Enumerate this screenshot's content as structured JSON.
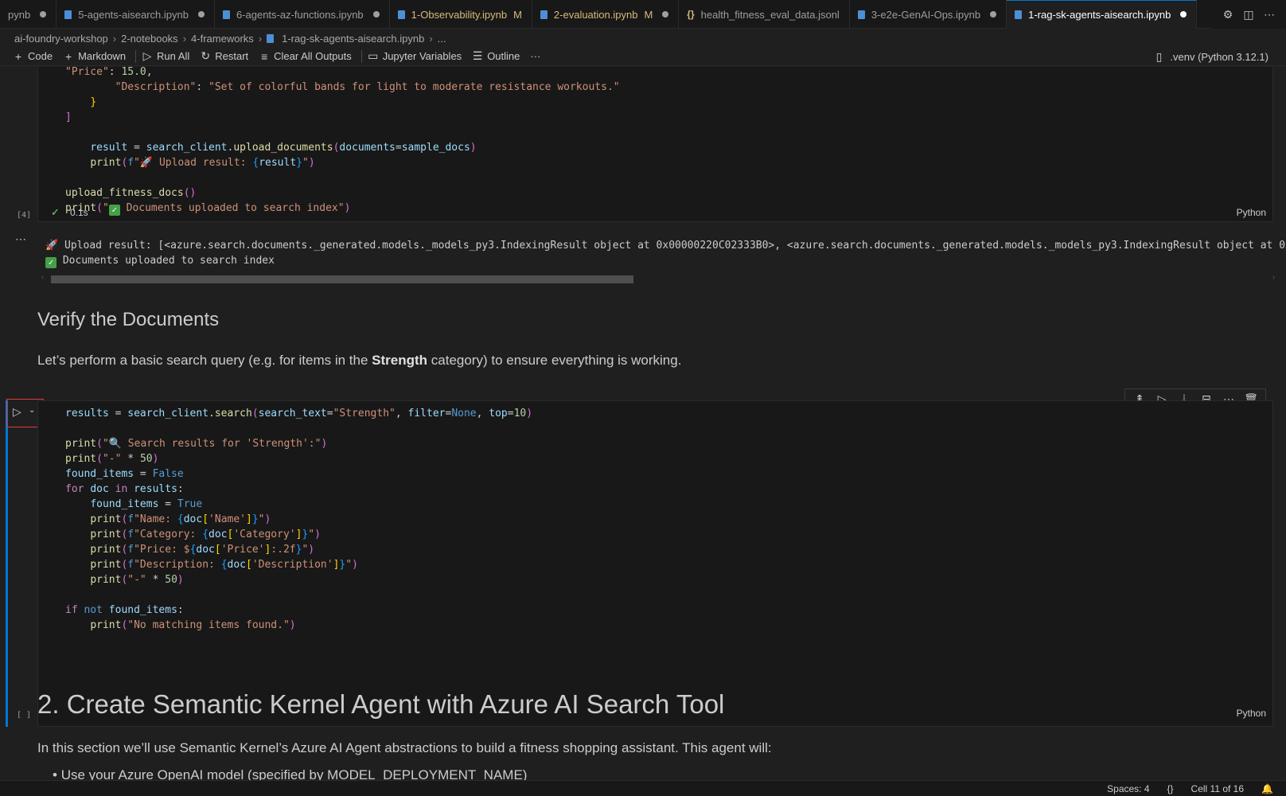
{
  "tabs": [
    {
      "name": "pynb",
      "type": "nb",
      "modified": false,
      "dirty": true,
      "active": false
    },
    {
      "name": "5-agents-aisearch.ipynb",
      "type": "nb",
      "modified": false,
      "dirty": true,
      "active": false
    },
    {
      "name": "6-agents-az-functions.ipynb",
      "type": "nb",
      "modified": false,
      "dirty": true,
      "active": false
    },
    {
      "name": "1-Observability.ipynb",
      "type": "nb",
      "modified": true,
      "dirty": false,
      "active": false,
      "badge": "M"
    },
    {
      "name": "2-evaluation.ipynb",
      "type": "nb",
      "modified": true,
      "dirty": true,
      "active": false,
      "badge": "M"
    },
    {
      "name": "health_fitness_eval_data.jsonl",
      "type": "json",
      "modified": false,
      "dirty": false,
      "active": false
    },
    {
      "name": "3-e2e-GenAI-Ops.ipynb",
      "type": "nb",
      "modified": false,
      "dirty": true,
      "active": false
    },
    {
      "name": "1-rag-sk-agents-aisearch.ipynb",
      "type": "nb",
      "modified": false,
      "dirty": true,
      "active": true
    }
  ],
  "breadcrumb": {
    "parts": [
      "ai-foundry-workshop",
      "2-notebooks",
      "4-frameworks",
      "1-rag-sk-agents-aisearch.ipynb",
      "..."
    ]
  },
  "toolbar": {
    "code": "Code",
    "markdown": "Markdown",
    "run_all": "Run All",
    "restart": "Restart",
    "clear_outputs": "Clear All Outputs",
    "jupyter_variables": "Jupyter Variables",
    "outline": "Outline",
    "more": "···",
    "kernel": ".venv (Python 3.12.1)"
  },
  "cell4": {
    "exec_count": "[4]",
    "duration": "0.1s",
    "language": "Python",
    "output_line1": "Upload result: [<azure.search.documents._generated.models._models_py3.IndexingResult object at 0x00000220C02333B0>, <azure.search.documents._generated.models._models_py3.IndexingResult object at 0x0",
    "output_line2": "Documents uploaded to search index"
  },
  "markdown1": {
    "heading": "Verify the Documents",
    "para_before": "Let’s perform a basic search query (e.g. for items in the ",
    "para_bold": "Strength",
    "para_after": " category) to ensure everything is working."
  },
  "cell11": {
    "exec_count": "[ ]",
    "language": "Python"
  },
  "markdown2": {
    "heading": "2. Create Semantic Kernel Agent with Azure AI Search Tool",
    "para": "In this section we’ll use Semantic Kernel’s Azure AI Agent abstractions to build a fitness shopping assistant. This agent will:",
    "bullet": "Use your Azure OpenAI model (specified by MODEL_DEPLOYMENT_NAME)"
  },
  "status": {
    "spaces": "Spaces: 4",
    "braces": "{}",
    "cell": "Cell 11 of 16"
  },
  "colors": {
    "accent": "#0078d4",
    "success": "#43a047",
    "highlight_border": "#e03c3c"
  }
}
